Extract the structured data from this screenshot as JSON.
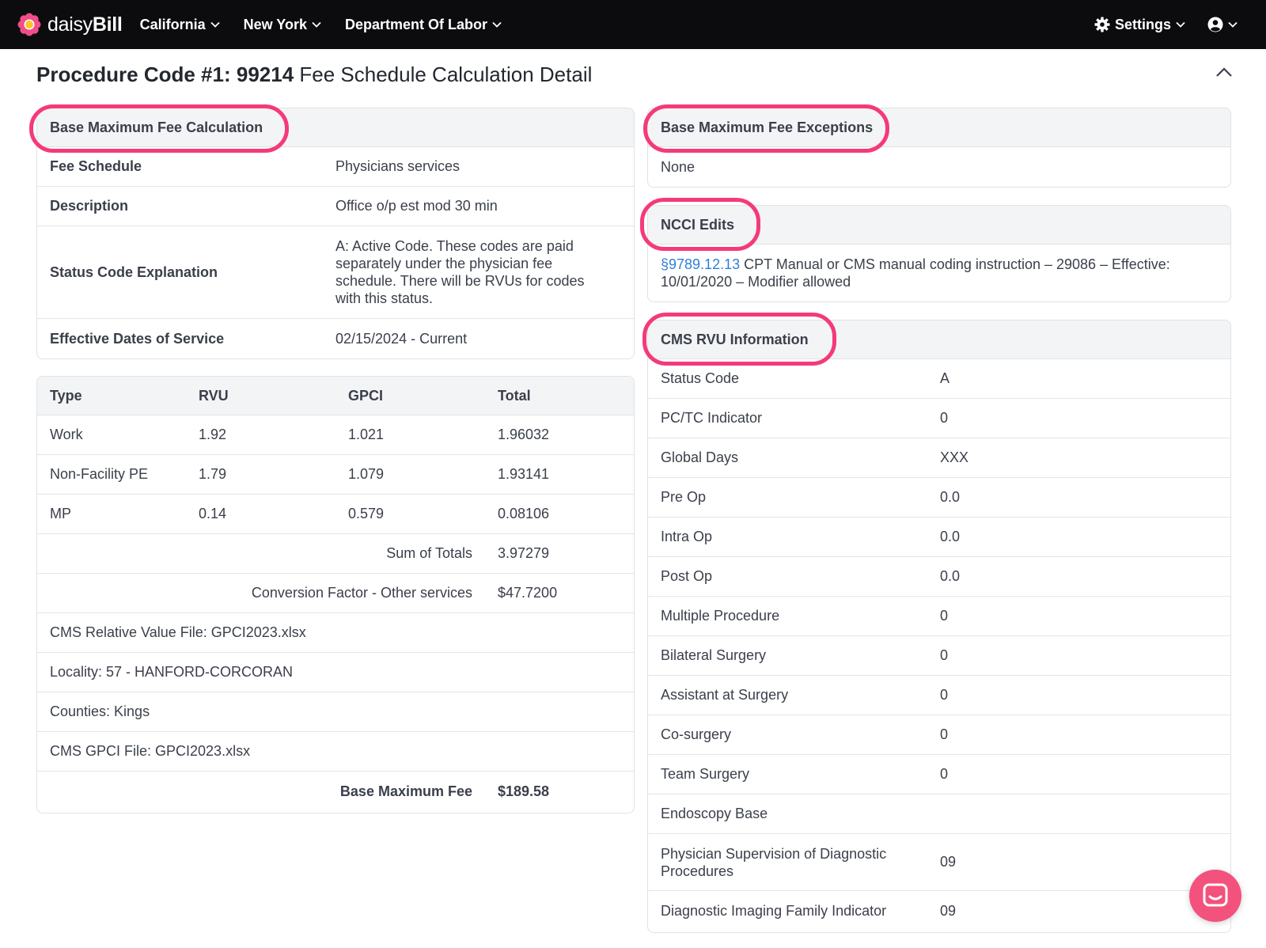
{
  "nav": {
    "brand_light": "daisy",
    "brand_bold": "Bill",
    "items": [
      {
        "label": "California"
      },
      {
        "label": "New York"
      },
      {
        "label": "Department Of Labor"
      }
    ],
    "settings_label": "Settings"
  },
  "page": {
    "title_bold": "Procedure Code #1: 99214",
    "title_rest": "Fee Schedule Calculation Detail"
  },
  "base_calc": {
    "header": "Base Maximum Fee Calculation",
    "rows": [
      {
        "label": "Fee Schedule",
        "value": "Physicians services"
      },
      {
        "label": "Description",
        "value": "Office o/p est mod 30 min"
      },
      {
        "label": "Status Code Explanation",
        "value": "A: Active Code. These codes are paid separately under the physician fee schedule. There will be RVUs for codes with this status."
      },
      {
        "label": "Effective Dates of Service",
        "value": "02/15/2024 - Current"
      }
    ]
  },
  "rvu_table": {
    "headers": [
      "Type",
      "RVU",
      "GPCI",
      "Total"
    ],
    "rows": [
      [
        "Work",
        "1.92",
        "1.021",
        "1.96032"
      ],
      [
        "Non-Facility PE",
        "1.79",
        "1.079",
        "1.93141"
      ],
      [
        "MP",
        "0.14",
        "0.579",
        "0.08106"
      ]
    ],
    "sum_label": "Sum of Totals",
    "sum_value": "3.97279",
    "cf_label": "Conversion Factor - Other services",
    "cf_value": "$47.7200",
    "notes": [
      "CMS Relative Value File: GPCI2023.xlsx",
      "Locality: 57 - HANFORD-CORCORAN",
      "Counties: Kings",
      "CMS GPCI File: GPCI2023.xlsx"
    ],
    "base_fee_label": "Base Maximum Fee",
    "base_fee_value": "$189.58"
  },
  "exceptions": {
    "header": "Base Maximum Fee Exceptions",
    "value": "None"
  },
  "ncci": {
    "header": "NCCI Edits",
    "link": "§9789.12.13",
    "text": "CPT Manual or CMS manual coding instruction – 29086 – Effective: 10/01/2020 – Modifier allowed"
  },
  "cms_rvu": {
    "header": "CMS RVU Information",
    "rows": [
      {
        "label": "Status Code",
        "value": "A"
      },
      {
        "label": "PC/TC Indicator",
        "value": "0"
      },
      {
        "label": "Global Days",
        "value": "XXX"
      },
      {
        "label": "Pre Op",
        "value": "0.0"
      },
      {
        "label": "Intra Op",
        "value": "0.0"
      },
      {
        "label": "Post Op",
        "value": "0.0"
      },
      {
        "label": "Multiple Procedure",
        "value": "0"
      },
      {
        "label": "Bilateral Surgery",
        "value": "0"
      },
      {
        "label": "Assistant at Surgery",
        "value": "0"
      },
      {
        "label": "Co-surgery",
        "value": "0"
      },
      {
        "label": "Team Surgery",
        "value": "0"
      },
      {
        "label": "Endoscopy Base",
        "value": ""
      },
      {
        "label": "Physician Supervision of Diagnostic Procedures",
        "value": "09"
      },
      {
        "label": "Diagnostic Imaging Family Indicator",
        "value": "09"
      }
    ]
  },
  "colors": {
    "highlight": "#f43a79",
    "nav_bg": "#0c0c0e",
    "link": "#2f7fd6",
    "chat": "#f3527d"
  }
}
